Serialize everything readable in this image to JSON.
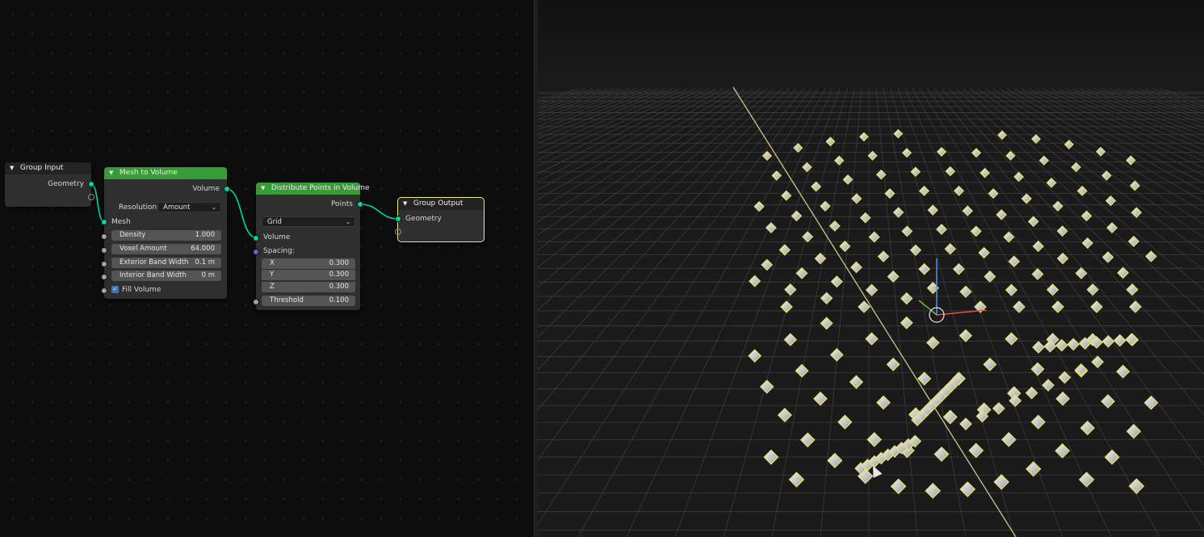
{
  "node_editor": {
    "nodes": {
      "group_input": {
        "title": "Group Input",
        "outputs": [
          "Geometry"
        ]
      },
      "mesh_to_volume": {
        "title": "Mesh to Volume",
        "output": "Volume",
        "resolution_label": "Resolution",
        "resolution_value": "Amount",
        "input_mesh": "Mesh",
        "fields": [
          {
            "label": "Density",
            "value": "1.000"
          },
          {
            "label": "Voxel Amount",
            "value": "64.000"
          },
          {
            "label": "Exterior Band Width",
            "value": "0.1 m"
          },
          {
            "label": "Interior Band Width",
            "value": "0 m"
          }
        ],
        "fill_volume_label": "Fill Volume",
        "fill_volume_checked": true
      },
      "distribute_points": {
        "title": "Distribute Points in Volume",
        "output": "Points",
        "mode_value": "Grid",
        "input_volume": "Volume",
        "spacing_label": "Spacing:",
        "spacing": [
          {
            "label": "X",
            "value": "0.300"
          },
          {
            "label": "Y",
            "value": "0.300"
          },
          {
            "label": "Z",
            "value": "0.300"
          }
        ],
        "threshold_label": "Threshold",
        "threshold_value": "0.100"
      },
      "group_output": {
        "title": "Group Output",
        "inputs": [
          "Geometry"
        ]
      }
    },
    "colors": {
      "header_green": "#379c36",
      "geometry_socket": "#00d6a3",
      "float_socket": "#a1a1a1",
      "vector_socket": "#6b63c7",
      "selection_outline": "#ede98a"
    }
  },
  "viewport": {
    "grid_color": "#3c3c3c",
    "axis_line_color": "#c9c98a",
    "instance_fill": "#d9d9d9",
    "instance_outline": "#e4e46a",
    "gizmo_colors": [
      "#e05252",
      "#5fbf4a",
      "#5b8fe8"
    ]
  }
}
